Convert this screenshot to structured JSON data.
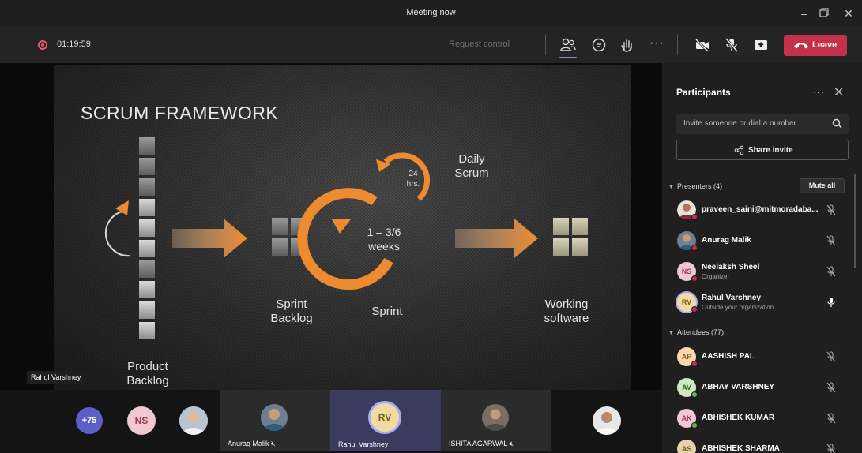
{
  "window": {
    "title": "Meeting now"
  },
  "toolbar": {
    "timer": "01:19:59",
    "request_control": "Request control",
    "leave_label": "Leave",
    "colors": {
      "leave": "#c4314b",
      "record": "#e35b6d",
      "active_underline": "#8b8cc7"
    }
  },
  "slide": {
    "title": "SCRUM FRAMEWORK",
    "labels": {
      "product_backlog": "Product\nBacklog",
      "sprint_backlog": "Sprint\nBacklog",
      "sprint": "Sprint",
      "working_software": "Working\nsoftware",
      "daily_scrum": "Daily\nScrum",
      "weeks": "1 – 3/6\nweeks",
      "hours": "24\nhrs."
    },
    "presenter_tag": "Rahul Varshney",
    "colors": {
      "accent": "#e8862a"
    }
  },
  "strip": {
    "overflow_count": "+75",
    "ns_initials": "NS",
    "rv_initials": "RV",
    "tiles": [
      {
        "name": "Anurag Malik"
      },
      {
        "name": "Rahul Varshney"
      },
      {
        "name": "ISHITA AGARWAL"
      }
    ]
  },
  "panel": {
    "title": "Participants",
    "search_placeholder": "Invite someone or dial a number",
    "share_label": "Share invite",
    "presenters_header": "Presenters (4)",
    "mute_all": "Mute all",
    "attendees_header": "Attendees (77)",
    "presenters": [
      {
        "name": "praveen_saini@mitmoradaba...",
        "sub": "",
        "initials": "",
        "avatar_color": "#6b5a4a",
        "mic": "muted"
      },
      {
        "name": "Anurag Malik",
        "sub": "",
        "initials": "",
        "avatar_color": "#5a6e86",
        "mic": "muted"
      },
      {
        "name": "Neelaksh Sheel",
        "sub": "Organizer",
        "initials": "NS",
        "avatar_color": "#f0c8d2",
        "mic": "muted"
      },
      {
        "name": "Rahul Varshney",
        "sub": "Outside your organization",
        "initials": "RV",
        "avatar_color": "#f2dba3",
        "mic": "active"
      }
    ],
    "attendees": [
      {
        "name": "AASHISH PAL",
        "initials": "AP",
        "avatar_color": "#f7d9b0",
        "mic": "muted"
      },
      {
        "name": "ABHAY VARSHNEY",
        "initials": "AV",
        "avatar_color": "#cfe8c4",
        "mic": "muted"
      },
      {
        "name": "ABHISHEK KUMAR",
        "initials": "AK",
        "avatar_color": "#f3c7d6",
        "mic": "muted"
      },
      {
        "name": "ABHISHEK SHARMA",
        "initials": "AS",
        "avatar_color": "#e7d3a8",
        "mic": "muted"
      }
    ]
  }
}
